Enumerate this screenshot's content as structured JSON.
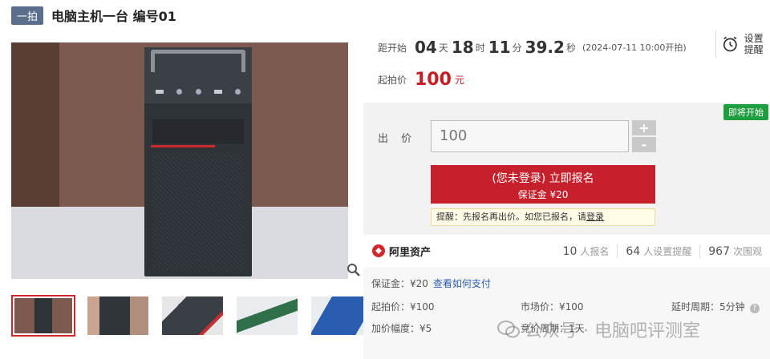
{
  "header": {
    "badge": "一拍",
    "title": "电脑主机一台 编号01"
  },
  "countdown": {
    "label": "距开始",
    "days": "04",
    "days_unit": "天",
    "hours": "18",
    "hours_unit": "时",
    "minutes": "11",
    "minutes_unit": "分",
    "seconds": "39.2",
    "seconds_unit": "秒",
    "start_note": "(2024-07-11 10:00开拍)"
  },
  "start_price": {
    "label": "起拍价",
    "value": "100",
    "unit": "元"
  },
  "reminder": {
    "label_line1": "设置",
    "label_line2": "提醒"
  },
  "bid": {
    "status_tag": "即将开始",
    "label": "出 价",
    "input_value": "100",
    "plus": "+",
    "minus": "-",
    "signup_line1": "(您未登录) 立即报名",
    "signup_line2": "保证金 ¥20",
    "tip_text": "提醒：先报名再出价。如您已报名，请",
    "tip_link": "登录"
  },
  "stats": {
    "brand": "阿里资产",
    "signups": "10",
    "signups_label": "人报名",
    "reminders": "64",
    "reminders_label": "人设置提醒",
    "watchers": "967",
    "watchers_label": "次围观"
  },
  "info": {
    "deposit": "保证金：¥20",
    "payment_link": "查看如何支付",
    "start_price": "起拍价：¥100",
    "market_price": "市场价：¥100",
    "delay_period": "延时周期：5分钟",
    "increment": "加价幅度：¥5",
    "bid_period": "竞价周期：1天"
  },
  "watermark": "公众号 · 电脑吧评测室",
  "colors": {
    "accent_red": "#c5202b",
    "status_green": "#1e9e3e",
    "badge_blue": "#5b6e8c"
  }
}
